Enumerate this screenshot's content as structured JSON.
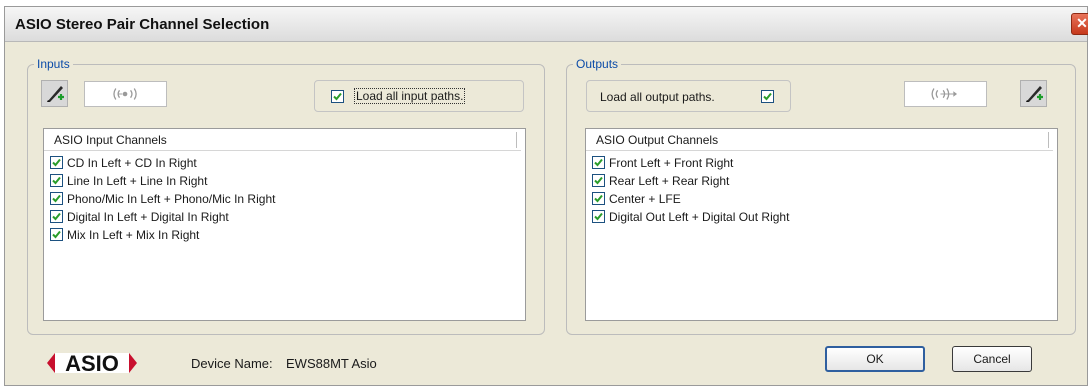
{
  "window": {
    "title": "ASIO Stereo Pair Channel Selection",
    "close_glyph": "✕"
  },
  "inputs": {
    "group_label": "Inputs",
    "load_all_label": "Load all input paths.",
    "load_all_checked": true,
    "list_header": "ASIO Input Channels",
    "channels": [
      {
        "label": "CD In Left  +  CD In Right",
        "checked": true
      },
      {
        "label": "Line In Left  +  Line In Right",
        "checked": true
      },
      {
        "label": "Phono/Mic In Left  +  Phono/Mic In Right",
        "checked": true
      },
      {
        "label": "Digital In Left  +  Digital In Right",
        "checked": true
      },
      {
        "label": "Mix In Left  +  Mix In Right",
        "checked": true
      }
    ],
    "icons": {
      "add": "pen-add-icon",
      "signal": "signal-input-icon"
    }
  },
  "outputs": {
    "group_label": "Outputs",
    "load_all_label": "Load all output paths.",
    "load_all_checked": true,
    "list_header": "ASIO Output Channels",
    "channels": [
      {
        "label": "Front Left  +  Front Right",
        "checked": true
      },
      {
        "label": "Rear Left  +  Rear Right",
        "checked": true
      },
      {
        "label": "Center  +  LFE",
        "checked": true
      },
      {
        "label": "Digital Out Left  +  Digital Out Right",
        "checked": true
      }
    ],
    "icons": {
      "add": "pen-add-icon",
      "signal": "signal-output-icon"
    }
  },
  "footer": {
    "logo_text": "ASIO",
    "device_label": "Device Name:",
    "device_name": "EWS88MT Asio",
    "ok_label": "OK",
    "cancel_label": "Cancel"
  },
  "colors": {
    "dialog_bg": "#ece9d8",
    "legend_blue": "#0b4ba8",
    "check_green": "#2a9d2a",
    "logo_red": "#c8102e"
  }
}
